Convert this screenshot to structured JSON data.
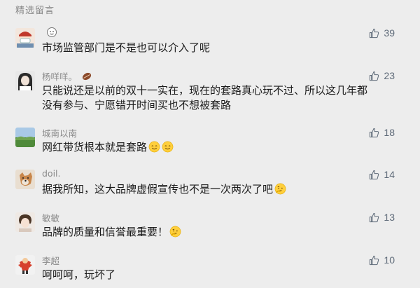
{
  "section_title": "精选留言",
  "colors": {
    "background": "#ededed",
    "name": "#8a8a8a",
    "text": "#1a1a1a",
    "like": "#5f6b79"
  },
  "comments": [
    {
      "name": "",
      "name_icon": "smiley-face-icon",
      "text": "市场监管部门是不是也可以介入了呢",
      "likes": "39",
      "emojis": []
    },
    {
      "name": "杨咩咩。",
      "name_icon": "coffee-bean-icon",
      "text": "只能说还是以前的双十一实在，现在的套路真心玩不过、所以这几年都没有参与、宁愿错开时间买也不想被套路",
      "likes": "23",
      "emojis": []
    },
    {
      "name": "城南以南",
      "text": "网红带货根本就是套路",
      "likes": "18",
      "emojis": [
        "smile-emoji",
        "smile-emoji"
      ]
    },
    {
      "name": "doil.",
      "text": "据我所知，这大品牌虚假宣传也不是一次两次了吧",
      "likes": "14",
      "emojis": [
        "thinking-emoji"
      ]
    },
    {
      "name": "敏敏",
      "text": "品牌的质量和信誉最重要！",
      "likes": "13",
      "emojis": [
        "thinking-emoji"
      ]
    },
    {
      "name": "李超",
      "text": "呵呵呵，玩坏了",
      "likes": "10",
      "emojis": []
    }
  ]
}
